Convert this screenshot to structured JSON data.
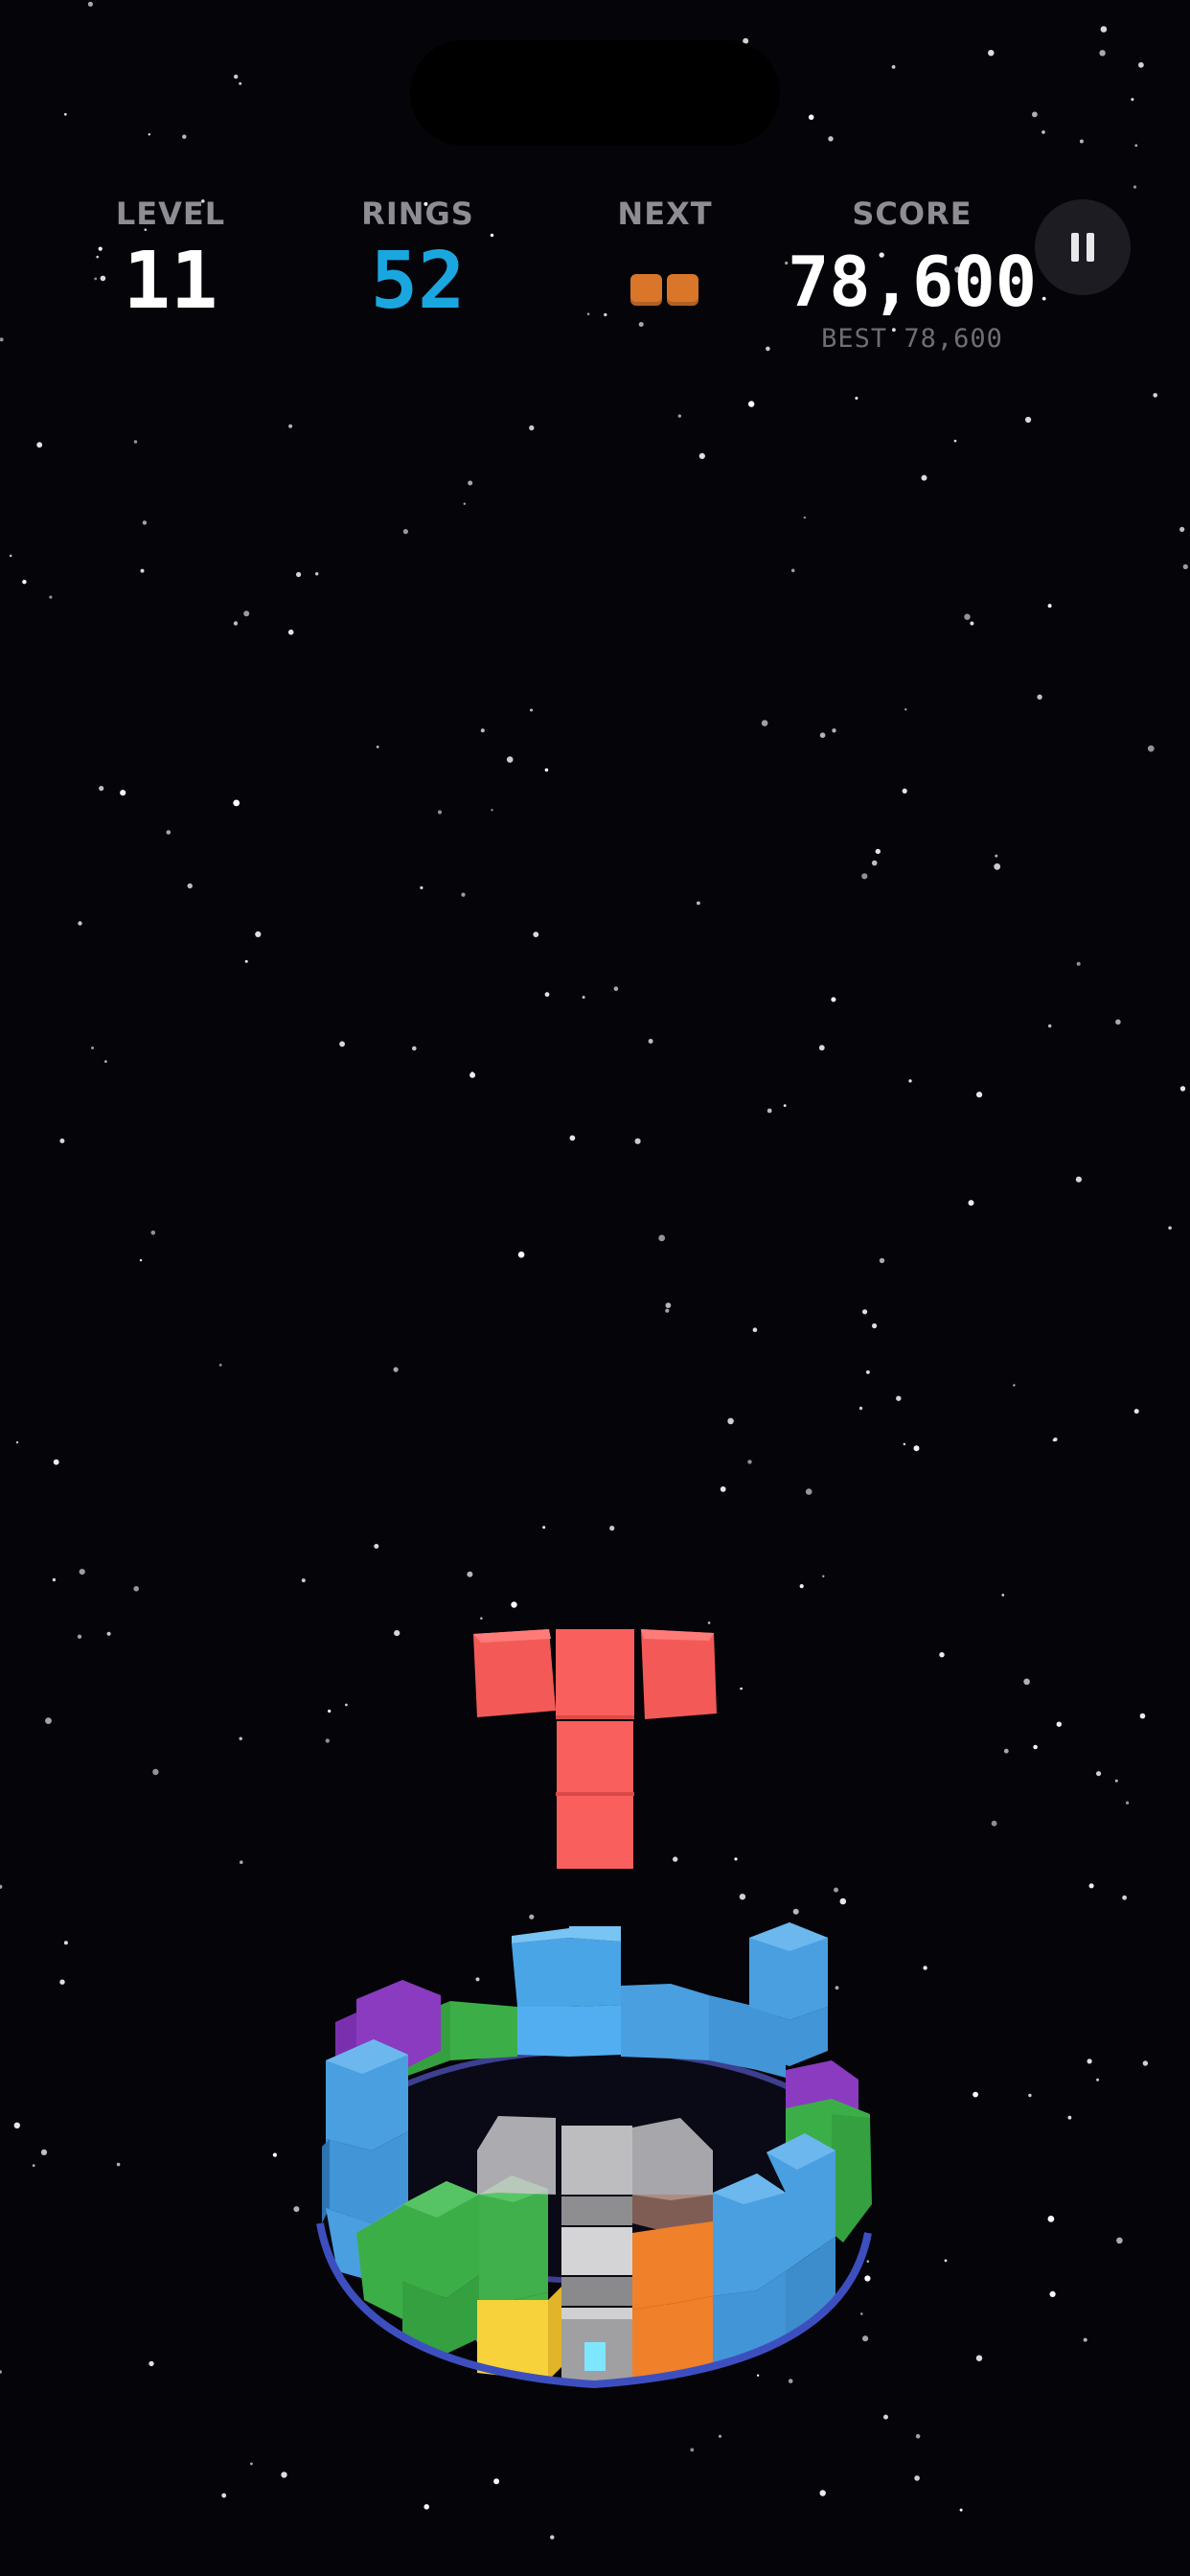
{
  "hud": {
    "level_label": "LEVEL",
    "level_value": "11",
    "rings_label": "RINGS",
    "rings_value": "52",
    "next_label": "NEXT",
    "score_label": "SCORE",
    "score_value": "78,600",
    "best_text": "BEST 78,600"
  },
  "pause_button": {
    "icon": "pause-icon"
  },
  "next_piece": {
    "type": "domino",
    "cells": 2,
    "color": "#d9762a"
  },
  "active_piece": {
    "type": "T-tetromino",
    "color": "#f85f5c",
    "orientation": "T pointing down"
  },
  "colors": {
    "background": "#050409",
    "rings_accent": "#1aa7e0",
    "hud_value": "#ffffff",
    "hud_label": "#8d8d93",
    "block_blue": "#4a9fe0",
    "block_green": "#3cae48",
    "block_purple": "#8a3bc0",
    "block_orange": "#f0802a",
    "block_yellow": "#f8d23a",
    "block_gray": "#b9b9bb",
    "block_red": "#f85f5c",
    "highlight_cyan": "#7fe6ff"
  }
}
